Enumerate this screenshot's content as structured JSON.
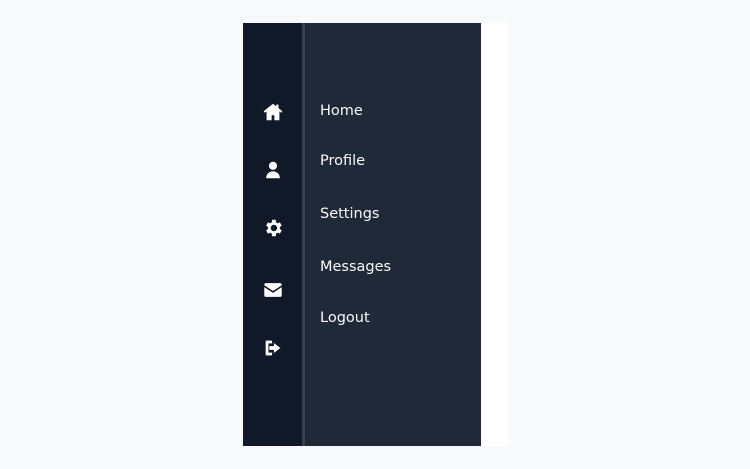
{
  "sidebar": {
    "items": [
      {
        "label": "Home",
        "icon": "home-icon"
      },
      {
        "label": "Profile",
        "icon": "user-icon"
      },
      {
        "label": "Settings",
        "icon": "gear-icon"
      },
      {
        "label": "Messages",
        "icon": "envelope-icon"
      },
      {
        "label": "Logout",
        "icon": "sign-out-icon"
      }
    ]
  },
  "colors": {
    "rail_background": "#111827",
    "panel_background": "#1f2937",
    "divider": "#334155",
    "text": "#f8fafc"
  }
}
